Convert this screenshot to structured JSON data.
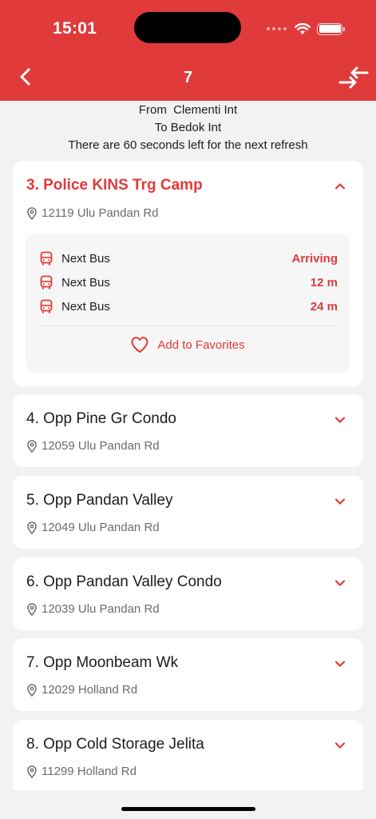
{
  "status_bar": {
    "time": "15:01"
  },
  "nav": {
    "title": "7"
  },
  "route": {
    "from": "From  Clementi Int",
    "to": "To Bedok Int",
    "refresh": "There are 60 seconds left for the next refresh"
  },
  "stops": [
    {
      "name": "3. Police KINS Trg Camp",
      "address": "12119 Ulu Pandan Rd",
      "expanded": true,
      "arrivals": [
        {
          "label": "Next Bus",
          "eta": "Arriving"
        },
        {
          "label": "Next Bus",
          "eta": "12 m"
        },
        {
          "label": "Next Bus",
          "eta": "24 m"
        }
      ],
      "favorite_label": "Add to Favorites"
    },
    {
      "name": "4. Opp Pine Gr Condo",
      "address": "12059 Ulu Pandan Rd",
      "expanded": false
    },
    {
      "name": "5. Opp Pandan Valley",
      "address": "12049 Ulu Pandan Rd",
      "expanded": false
    },
    {
      "name": "6. Opp Pandan Valley Condo",
      "address": "12039 Ulu Pandan Rd",
      "expanded": false
    },
    {
      "name": "7. Opp Moonbeam Wk",
      "address": "12029 Holland Rd",
      "expanded": false
    },
    {
      "name": "8. Opp Cold Storage Jelita",
      "address": "11299 Holland Rd",
      "expanded": false
    }
  ],
  "colors": {
    "accent": "#e03a3a",
    "background": "#f2f2f4",
    "card": "#ffffff"
  },
  "icons": {
    "back": "chevron-left-icon",
    "swap": "swap-arrows-icon",
    "location": "location-pin-icon",
    "bus": "bus-icon",
    "favorite": "heart-outline-icon",
    "expand": "chevron-down-icon",
    "collapse": "chevron-up-icon"
  }
}
